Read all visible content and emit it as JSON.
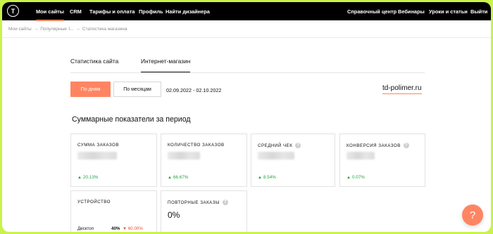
{
  "nav": {
    "logo": "T",
    "left": [
      "Мои сайты",
      "CRM",
      "Тарифы и оплата",
      "Профиль",
      "Найти дизайнера"
    ],
    "right": [
      "Справочный центр",
      "Вебинары",
      "Уроки и статьи",
      "Выйти"
    ]
  },
  "breadcrumb": [
    "Мои сайты",
    "Популярные т...",
    "Статистика магазина"
  ],
  "tabs": [
    "Статистика сайта",
    "Интернет-магазин"
  ],
  "period": {
    "by_days": "По дням",
    "by_months": "По месяцам",
    "date_range": "02.09.2022 - 02.10.2022"
  },
  "site_domain": "td-polimer.ru",
  "section_title": "Суммарные показатели за период",
  "cards": [
    {
      "label": "СУММА ЗАКАЗОВ",
      "delta": "20.13%"
    },
    {
      "label": "КОЛИЧЕСТВО ЗАКАЗОВ",
      "delta": "66.67%"
    },
    {
      "label": "СРЕДНИЙ ЧЕК",
      "delta": "8.54%"
    },
    {
      "label": "КОНВЕРСИЯ ЗАКАЗОВ",
      "delta": "0.07%"
    }
  ],
  "device_card": {
    "label": "УСТРОЙСТВО",
    "device": "Десктоп",
    "share": "40%",
    "change": "60.00%"
  },
  "repeat_card": {
    "label": "ПОВТОРНЫЕ ЗАКАЗЫ",
    "value": "0%"
  },
  "help": "?",
  "colors": {
    "accent": "#ff8562",
    "positive": "#25a244",
    "negative": "#e8533c",
    "frame": "#c9f24a"
  }
}
